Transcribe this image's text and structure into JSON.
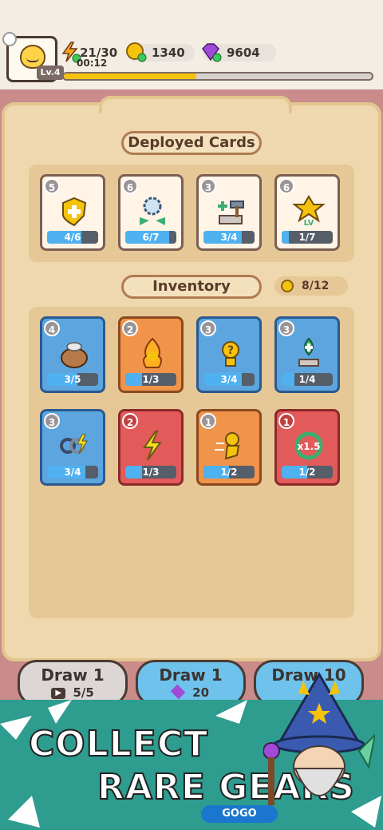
{
  "player": {
    "level": "Lv.4",
    "energy": "21/30",
    "energy_timer": "00:12",
    "coins": "1340",
    "gems": "9604",
    "xp_progress": 0.43
  },
  "deployed": {
    "title": "Deployed Cards",
    "cards": [
      {
        "level": "5",
        "progress": "4/6",
        "fraction": 0.67,
        "icon": "shield-plus-icon",
        "color": "cream"
      },
      {
        "level": "6",
        "progress": "6/7",
        "fraction": 0.86,
        "icon": "gear-arrows-icon",
        "color": "cream"
      },
      {
        "level": "3",
        "progress": "3/4",
        "fraction": 0.75,
        "icon": "hammer-heal-icon",
        "color": "cream"
      },
      {
        "level": "6",
        "progress": "1/7",
        "fraction": 0.14,
        "icon": "level-up-hero-icon",
        "color": "cream"
      }
    ]
  },
  "inventory": {
    "title": "Inventory",
    "count": "8/12",
    "cards": [
      {
        "level": "4",
        "progress": "3/5",
        "fraction": 0.6,
        "icon": "coin-bag-icon",
        "color": "blue"
      },
      {
        "level": "2",
        "progress": "1/3",
        "fraction": 0.33,
        "icon": "fire-hero-icon",
        "color": "orange"
      },
      {
        "level": "3",
        "progress": "3/4",
        "fraction": 0.75,
        "icon": "mystery-hero-icon",
        "color": "blue"
      },
      {
        "level": "3",
        "progress": "1/4",
        "fraction": 0.25,
        "icon": "heal-plant-icon",
        "color": "blue"
      },
      {
        "level": "3",
        "progress": "3/4",
        "fraction": 0.75,
        "icon": "chain-lightning-icon",
        "color": "blue"
      },
      {
        "level": "2",
        "progress": "1/3",
        "fraction": 0.33,
        "icon": "lightning-bolt-icon",
        "color": "red"
      },
      {
        "level": "1",
        "progress": "1/2",
        "fraction": 0.5,
        "icon": "dash-hero-icon",
        "color": "orange"
      },
      {
        "level": "1",
        "progress": "1/2",
        "fraction": 0.5,
        "icon": "speed-x1-5-icon",
        "color": "red"
      }
    ]
  },
  "draw_buttons": [
    {
      "title": "Draw 1",
      "cost": "5/5",
      "cost_icon": "video-icon"
    },
    {
      "title": "Draw 1",
      "cost": "20",
      "cost_icon": "gem-icon"
    },
    {
      "title": "Draw 10",
      "cost": "",
      "cost_icon": ""
    }
  ],
  "promo": {
    "line1": "COLLECT",
    "line2": "RARE GEARS"
  },
  "watermark": "GOGO",
  "colors": {
    "background": "#c98c8a",
    "panel": "#efd8ad",
    "card_blue": "#5da5de",
    "card_orange": "#f0944a",
    "card_red": "#e25a5a",
    "progress_fill": "#4fb1f0",
    "banner": "#2e9c8f"
  }
}
